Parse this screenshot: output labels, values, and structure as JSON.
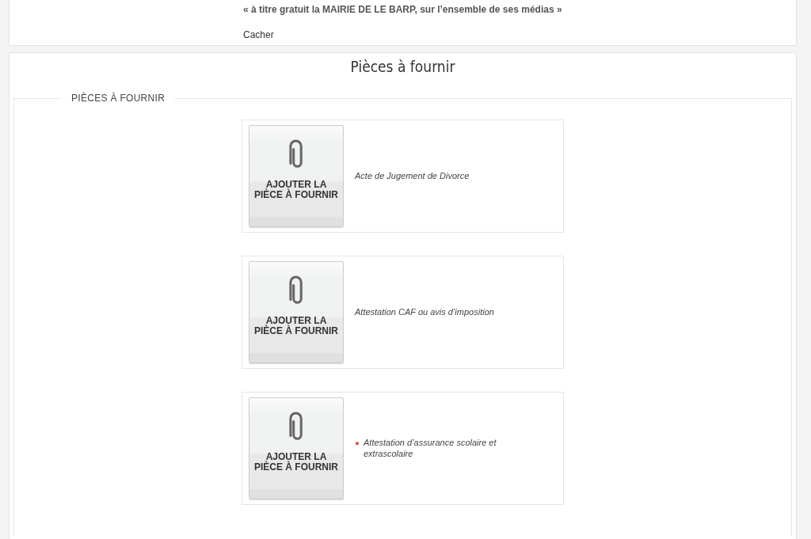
{
  "notice": {
    "quote": "« à titre gratuit la MAIRIE DE LE BARP, sur l’ensemble de ses médias »",
    "hide_link": "Cacher"
  },
  "section": {
    "title": "Pièces à fournir",
    "legend": "PIÈCES À FOURNIR",
    "documents": [
      {
        "button": "AJOUTER LA PIÈCE À FOURNIR",
        "label": "Acte de Jugement de Divorce",
        "required": false
      },
      {
        "button": "AJOUTER LA PIÈCE À FOURNIR",
        "label": "Attestation CAF ou avis d’imposition",
        "required": false
      },
      {
        "button": "AJOUTER LA PIÈCE À FOURNIR",
        "label": "Attestation d’assurance scolaire et extrascolaire",
        "required": true
      }
    ]
  }
}
